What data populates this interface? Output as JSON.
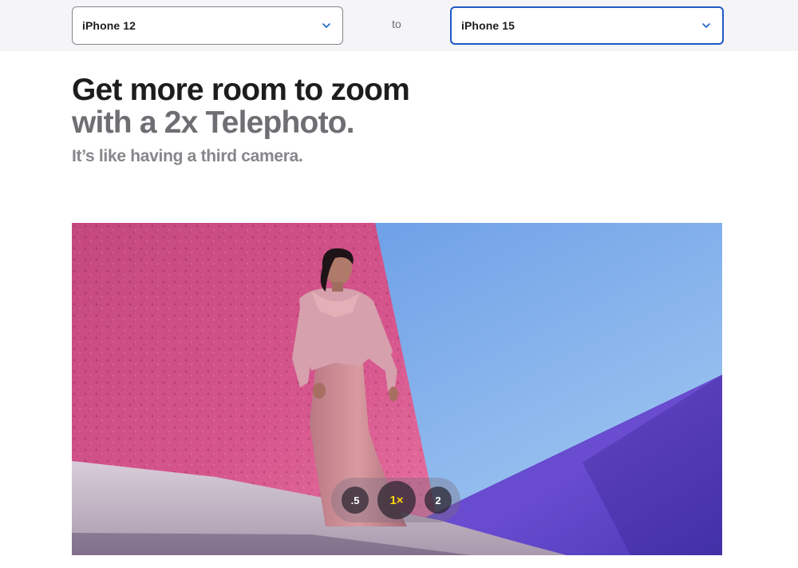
{
  "compare": {
    "left_select": {
      "value": "iPhone 12"
    },
    "connector": "to",
    "right_select": {
      "value": "iPhone 15"
    }
  },
  "hero": {
    "headline_line1": "Get more room to zoom",
    "headline_line2": "with a 2x Telephoto.",
    "subhead": "It’s like having a third camera."
  },
  "zoom_controls": {
    "options": [
      ".5",
      "1×",
      "2"
    ],
    "active": "1×"
  },
  "colors": {
    "accent_focus": "#2059c6",
    "active_zoom": "#ffd60a",
    "headline": "#1d1d1f",
    "headline_secondary": "#6e6e73"
  }
}
